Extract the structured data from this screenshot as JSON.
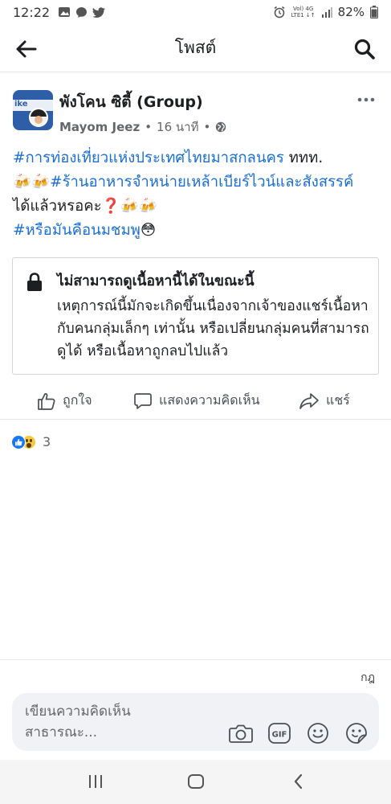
{
  "status_bar": {
    "time": "12:22",
    "network_top": "Vol) 4G",
    "network_bottom": "LTE1 ↓↑",
    "battery": "82%"
  },
  "app_bar": {
    "title": "โพสต์",
    "back_icon": "arrow-left-icon",
    "search_icon": "search-icon"
  },
  "post": {
    "group_name": "พังโคน ซิตี้ (Group)",
    "author": "Mayom Jeez",
    "separator": "•",
    "time_ago": "16 นาที",
    "privacy_separator": "•",
    "text_lines": [
      {
        "tag": "#การท่องเที่ยวแห่งประเทศไทยมาสกลนคร",
        "rest": " ททท."
      },
      {
        "prefix": "🍻🍻",
        "tag": "#ร้านอาหารจำหน่ายเหล้าเบียร์ไวน์และสังสรรค์",
        "rest": ""
      },
      {
        "tag": "",
        "rest": "ได้แล้วหรอคะ❓🍻🍻"
      },
      {
        "tag": "#หรือมันคือนมชมพู",
        "rest": "😳"
      }
    ]
  },
  "unavailable_box": {
    "title": "ไม่สามารถดูเนื้อหานี้ได้ในขณะนี้",
    "body": "เหตุการณ์นี้มักจะเกิดขึ้นเนื่องจากเจ้าของแชร์เนื้อหากับคนกลุ่มเล็กๆ เท่านั้น หรือเปลี่ยนกลุ่มคนที่สามารถดูได้ หรือเนื้อหาถูกลบไปแล้ว"
  },
  "actions": {
    "like": "ถูกใจ",
    "comment": "แสดงความคิดเห็น",
    "share": "แชร์"
  },
  "reactions": {
    "count": "3",
    "types": [
      "like",
      "wow"
    ]
  },
  "composer": {
    "keyboard_label": "กฎ",
    "placeholder": "เขียนความคิดเห็นสาธารณะ...",
    "icons": [
      "camera-icon",
      "gif-icon",
      "emoji-icon",
      "sticker-icon"
    ]
  },
  "colors": {
    "hashtag": "#1b6fd8",
    "like_blue": "#1877f2",
    "muted": "#65676b"
  }
}
